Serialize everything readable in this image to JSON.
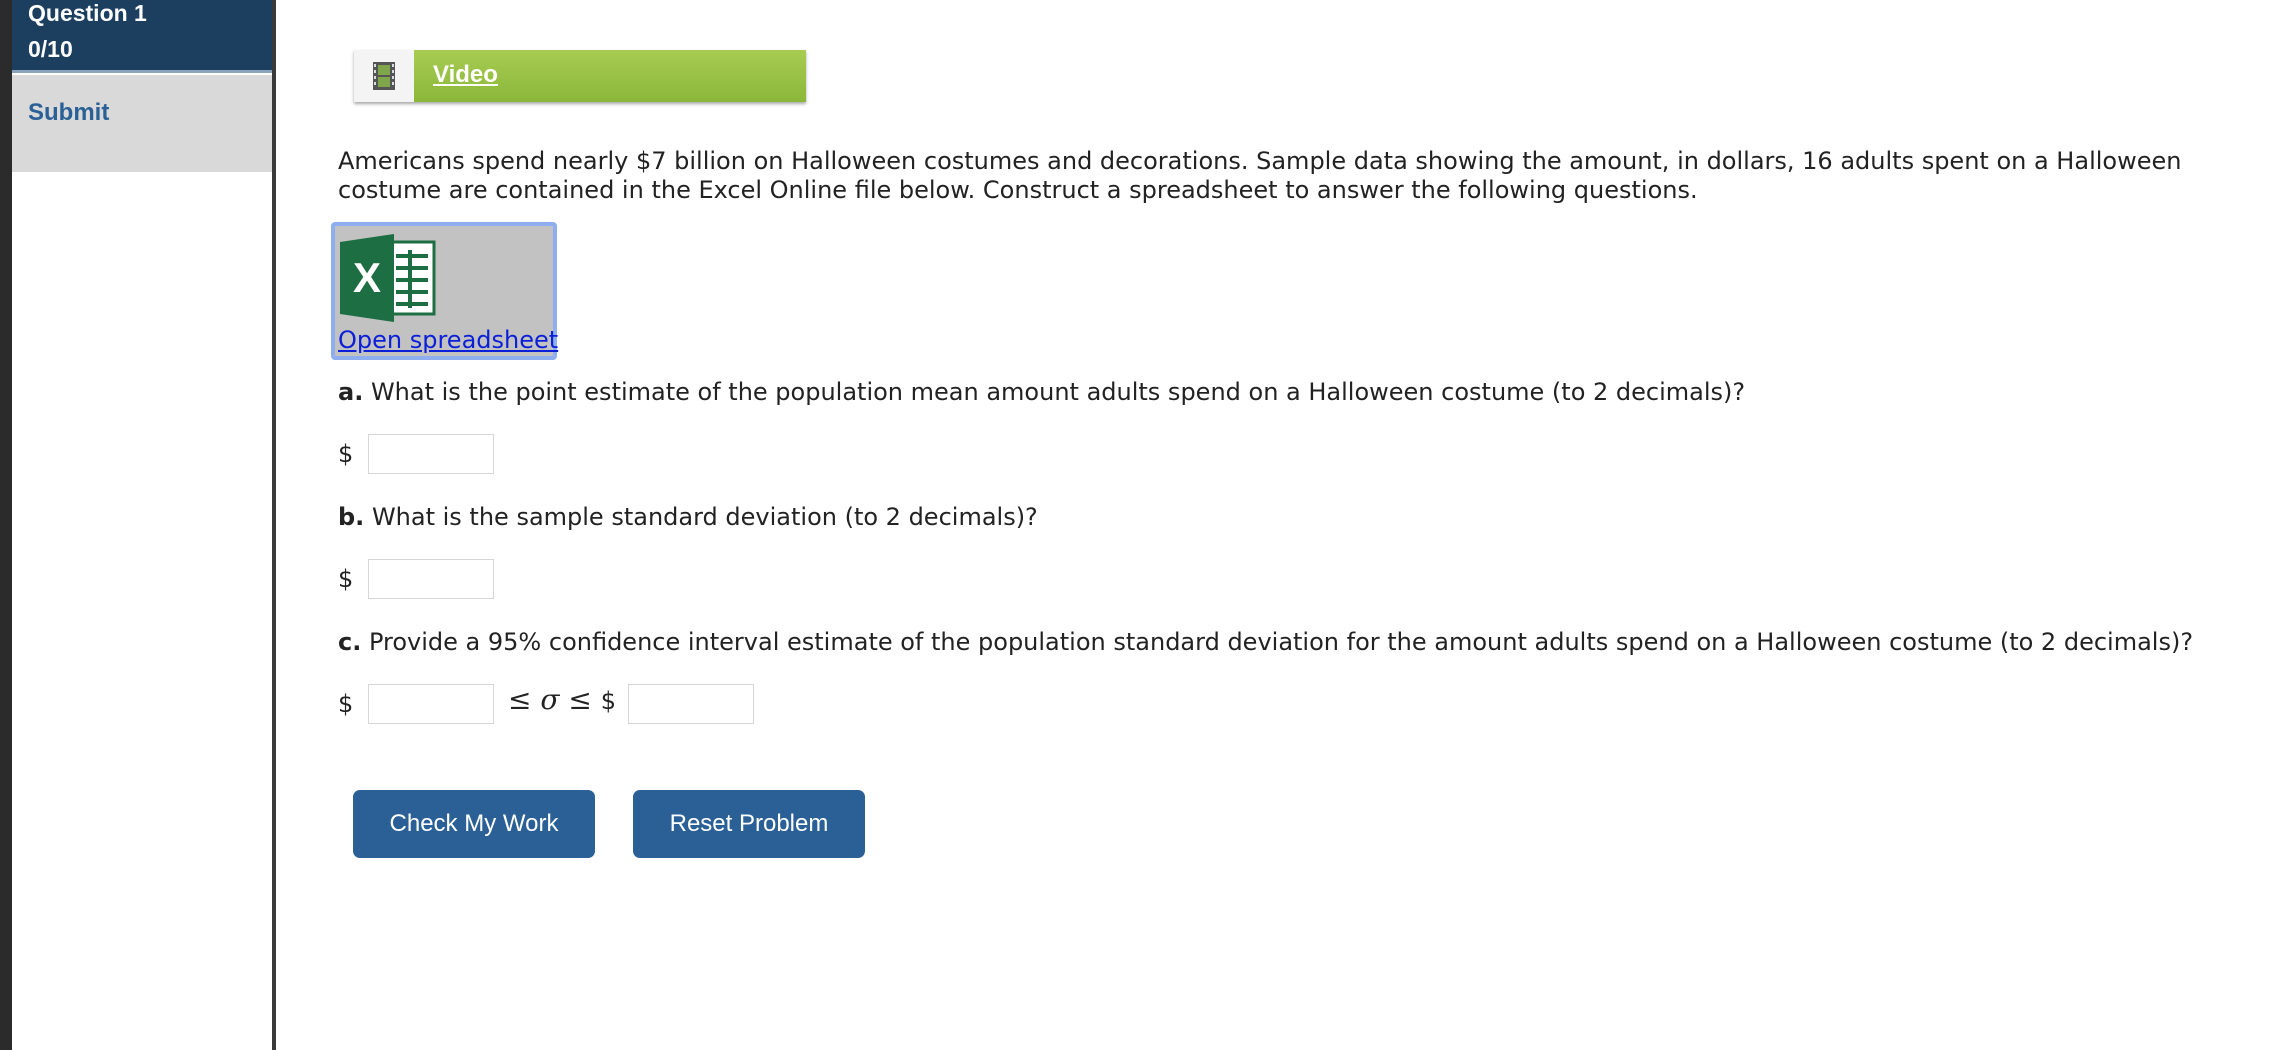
{
  "sidebar": {
    "question_title": "Question 1",
    "question_score": "0/10",
    "submit_label": "Submit"
  },
  "video": {
    "label": "Video",
    "icon": "film-icon",
    "accent_color": "#9bc444"
  },
  "intro_text": "Americans spend nearly $7 billion on Halloween costumes and decorations. Sample data showing the amount, in dollars, 16 adults spent on a Halloween costume are contained in the Excel Online file below. Construct a spreadsheet to answer the following questions.",
  "spreadsheet": {
    "link_label": "Open spreadsheet",
    "icon": "excel-icon"
  },
  "questions": {
    "a": {
      "letter": "a.",
      "text": "What is the point estimate of the population mean amount adults spend on a Halloween costume (to 2 decimals)?",
      "currency": "$",
      "value": ""
    },
    "b": {
      "letter": "b.",
      "text": "What is the sample standard deviation (to 2 decimals)?",
      "currency": "$",
      "value": ""
    },
    "c": {
      "letter": "c.",
      "text": "Provide a 95% confidence interval estimate of the population standard deviation for the amount adults spend on a Halloween costume (to 2 decimals)?",
      "currency": "$",
      "lower_value": "",
      "relation_left": "≤",
      "symbol": "σ",
      "relation_right": "≤",
      "currency_right": "$",
      "upper_value": ""
    }
  },
  "buttons": {
    "check_label": "Check My Work",
    "reset_label": "Reset Problem",
    "color": "#2a6096"
  },
  "colors": {
    "sidebar_header": "#1c3f60",
    "link": "#2a6096"
  }
}
